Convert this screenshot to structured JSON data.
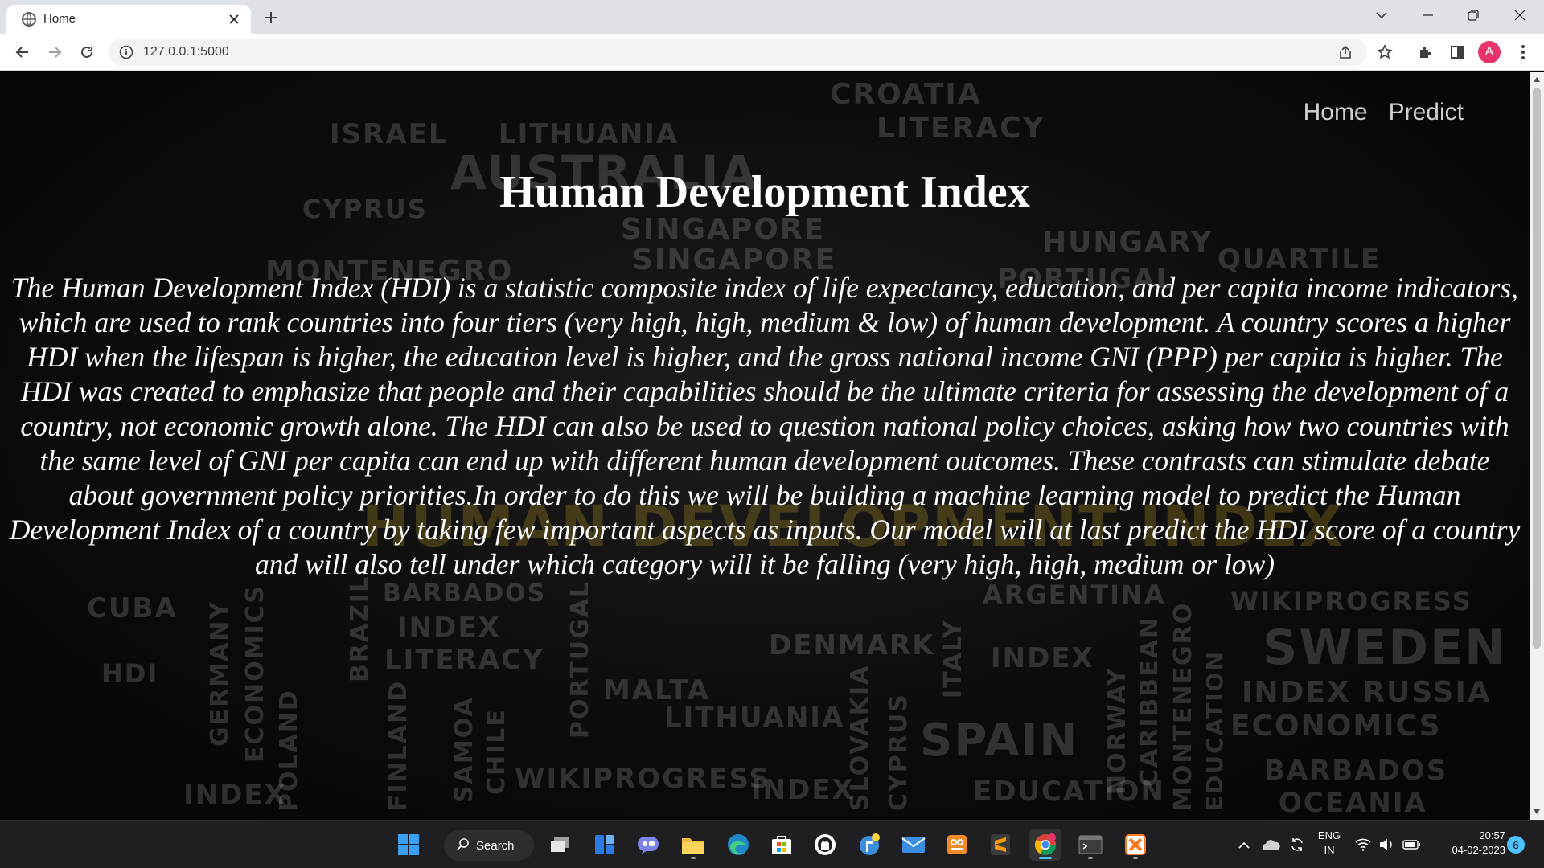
{
  "browser": {
    "tab_title": "Home",
    "url": "127.0.0.1:5000",
    "profile_initial": "A"
  },
  "page": {
    "nav": {
      "home": "Home",
      "predict": "Predict"
    },
    "title": "Human Development Index",
    "description": "The Human Development Index (HDI) is a statistic composite index of life expectancy, education, and per capita income indicators, which are used to rank countries into four tiers (very high, high, medium & low) of human development. A country scores a higher HDI when the lifespan is higher, the education level is higher, and the gross national income GNI (PPP) per capita is higher. The HDI was created to emphasize that people and their capabilities should be the ultimate criteria for assessing the development of a country, not economic growth alone. The HDI can also be used to question national policy choices, asking how two countries with the same level of GNI per capita can end up with different human development outcomes. These contrasts can stimulate debate about government policy priorities.In order to do this we will be building a machine learning model to predict the Human Development Index of a country by taking few important aspects as inputs. Our model will at last predict the HDI score of a country and will also tell under which category will it be falling (very high, high, medium or low)"
  },
  "background_words": [
    "ISRAEL",
    "LITHUANIA",
    "CROATIA",
    "LITERACY",
    "CYPRUS",
    "AUSTRALIA",
    "SINGAPORE",
    "SINGAPORE",
    "HUNGARY",
    "MONTENEGRO",
    "PORTUGAL",
    "QUARTILE",
    "CUBA",
    "HDI",
    "BARBADOS",
    "ARGENTINA",
    "WIKIPROGRESS",
    "INDEX",
    "LITERACY",
    "DENMARK",
    "INDEX",
    "SWEDEN",
    "INDEX RUSSIA",
    "ECONOMICS",
    "MALTA",
    "LITHUANIA",
    "SPAIN",
    "BARBADOS",
    "WIKIPROGRESS",
    "INDEX",
    "EDUCATION",
    "OCEANIA",
    "INDEX",
    "GERMANY",
    "ECONOMICS",
    "SAMOA",
    "CHILE",
    "NORWAY",
    "CARIBBEAN",
    "MONTENEGRO",
    "EDUCATION",
    "SLOVAKIA",
    "CYPRUS",
    "ITALY",
    "POLAND",
    "FINLAND",
    "BRAZIL",
    "PORTUGAL",
    "HUMAN DEVELOPMENT INDEX"
  ],
  "taskbar": {
    "search_label": "Search",
    "language": "ENG",
    "region": "IN",
    "time": "20:57",
    "date": "04-02-2023",
    "notifications": "6"
  },
  "colors": {
    "page_bg": "#0c0c0c",
    "title": "#ffffff",
    "nav_text": "#cfcfcf",
    "avatar": "#e8336b",
    "taskbar": "#1f1f22"
  }
}
